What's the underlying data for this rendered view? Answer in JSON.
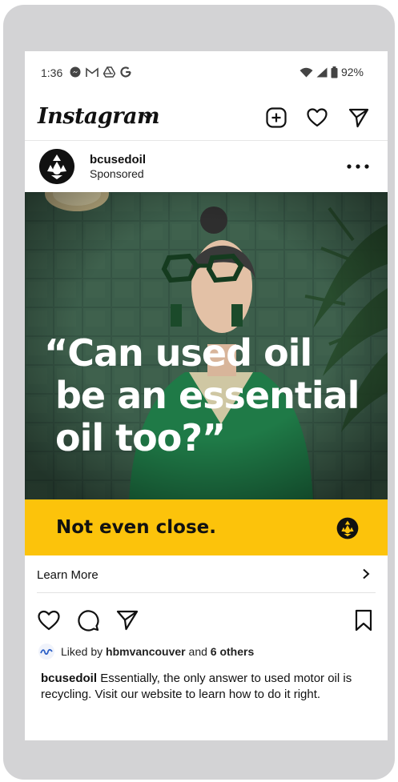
{
  "status_bar": {
    "time": "1:36",
    "left_icons": [
      "messenger-icon",
      "gmail-icon",
      "drive-icon",
      "google-icon"
    ],
    "battery": "92%"
  },
  "header": {
    "logo": "Instagram",
    "icons": [
      "new-post-icon",
      "heart-icon",
      "send-icon"
    ]
  },
  "post": {
    "username": "bcusedoil",
    "sponsored_label": "Sponsored",
    "ad": {
      "headline_lines": [
        "“Can used oil",
        "be an essential",
        "oil too?”"
      ],
      "banner_text": "Not even close.",
      "banner_color": "#fcc30b"
    },
    "cta_label": "Learn More",
    "likes": {
      "prefix": "Liked by",
      "first_liker": "hbmvancouver",
      "conjunction": "and",
      "others": "6 others"
    },
    "caption": {
      "username": "bcusedoil",
      "text": "Essentially, the only answer to used motor oil is recycling. Visit our website to learn how to do it right."
    }
  }
}
